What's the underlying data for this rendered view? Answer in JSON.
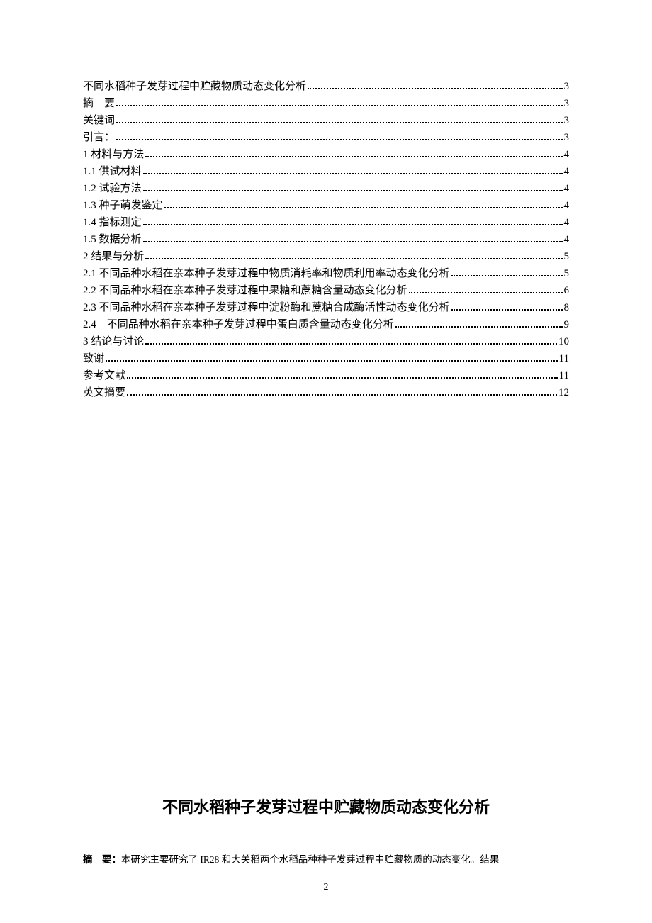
{
  "toc": [
    {
      "label": "不同水稻种子发芽过程中贮藏物质动态变化分析",
      "page": "3"
    },
    {
      "label": "摘　要",
      "page": "3"
    },
    {
      "label": "关键词",
      "page": "3"
    },
    {
      "label": "引言：",
      "page": "3"
    },
    {
      "label": "1 材料与方法",
      "page": "4"
    },
    {
      "label": "1.1 供试材料",
      "page": "4"
    },
    {
      "label": "1.2 试验方法",
      "page": "4"
    },
    {
      "label": "1.3 种子萌发鉴定",
      "page": "4"
    },
    {
      "label": "1.4 指标测定",
      "page": "4"
    },
    {
      "label": "1.5 数据分析",
      "page": "4"
    },
    {
      "label": "2 结果与分析",
      "page": "5"
    },
    {
      "label": "2.1 不同品种水稻在亲本种子发芽过程中物质消耗率和物质利用率动态变化分析",
      "page": "5"
    },
    {
      "label": "2.2 不同品种水稻在亲本种子发芽过程中果糖和蔗糖含量动态变化分析",
      "page": "6"
    },
    {
      "label": "2.3 不同品种水稻在亲本种子发芽过程中淀粉酶和蔗糖合成酶活性动态变化分析",
      "page": "8"
    },
    {
      "label": "2.4　不同品种水稻在亲本种子发芽过程中蛋白质含量动态变化分析",
      "page": "9"
    },
    {
      "label": "3 结论与讨论",
      "page": "10"
    },
    {
      "label": "致谢",
      "page": "11"
    },
    {
      "label": "参考文献",
      "page": "11"
    },
    {
      "label": "英文摘要",
      "page": "12"
    }
  ],
  "title": "不同水稻种子发芽过程中贮藏物质动态变化分析",
  "abstract_label": "摘　要：",
  "abstract_text": "本研究主要研究了 IR28 和大关稻两个水稻品种种子发芽过程中贮藏物质的动态变化。结果",
  "page_number": "2"
}
